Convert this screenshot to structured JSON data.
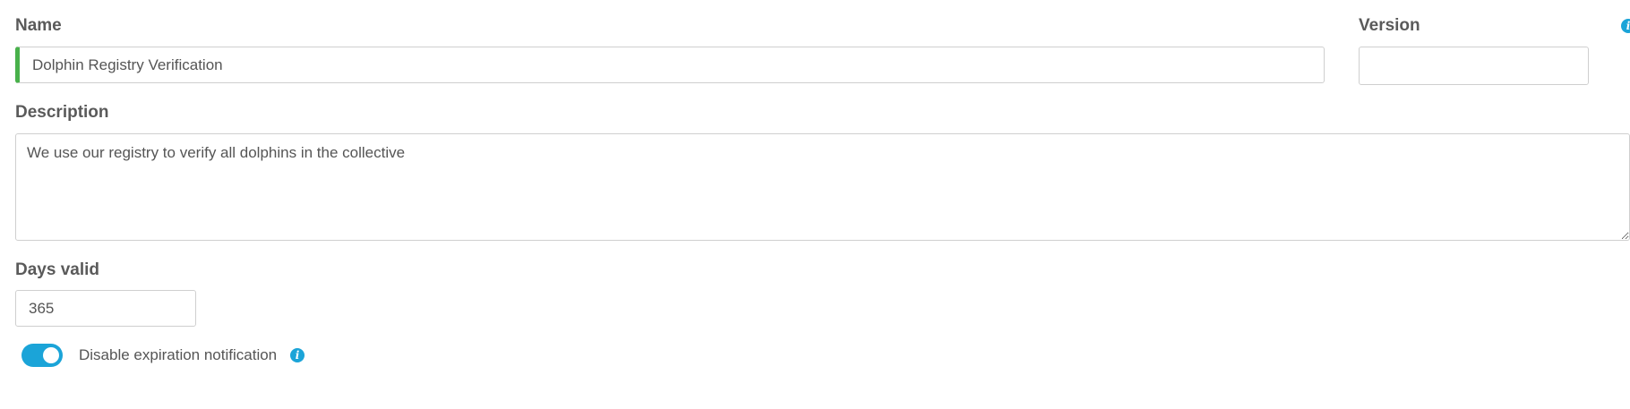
{
  "form": {
    "name": {
      "label": "Name",
      "value": "Dolphin Registry Verification"
    },
    "version": {
      "label": "Version",
      "value": ""
    },
    "description": {
      "label": "Description",
      "value": "We use our registry to verify all dolphins in the collective"
    },
    "days_valid": {
      "label": "Days valid",
      "value": "365"
    },
    "disable_expiration_notification": {
      "label": "Disable expiration notification",
      "enabled": true,
      "info_icon": "info-icon"
    }
  },
  "colors": {
    "accent": "#1ba4d8",
    "valid_indicator": "#48b14b",
    "border": "#cfcfcf",
    "label_text": "#5a5a5a"
  }
}
